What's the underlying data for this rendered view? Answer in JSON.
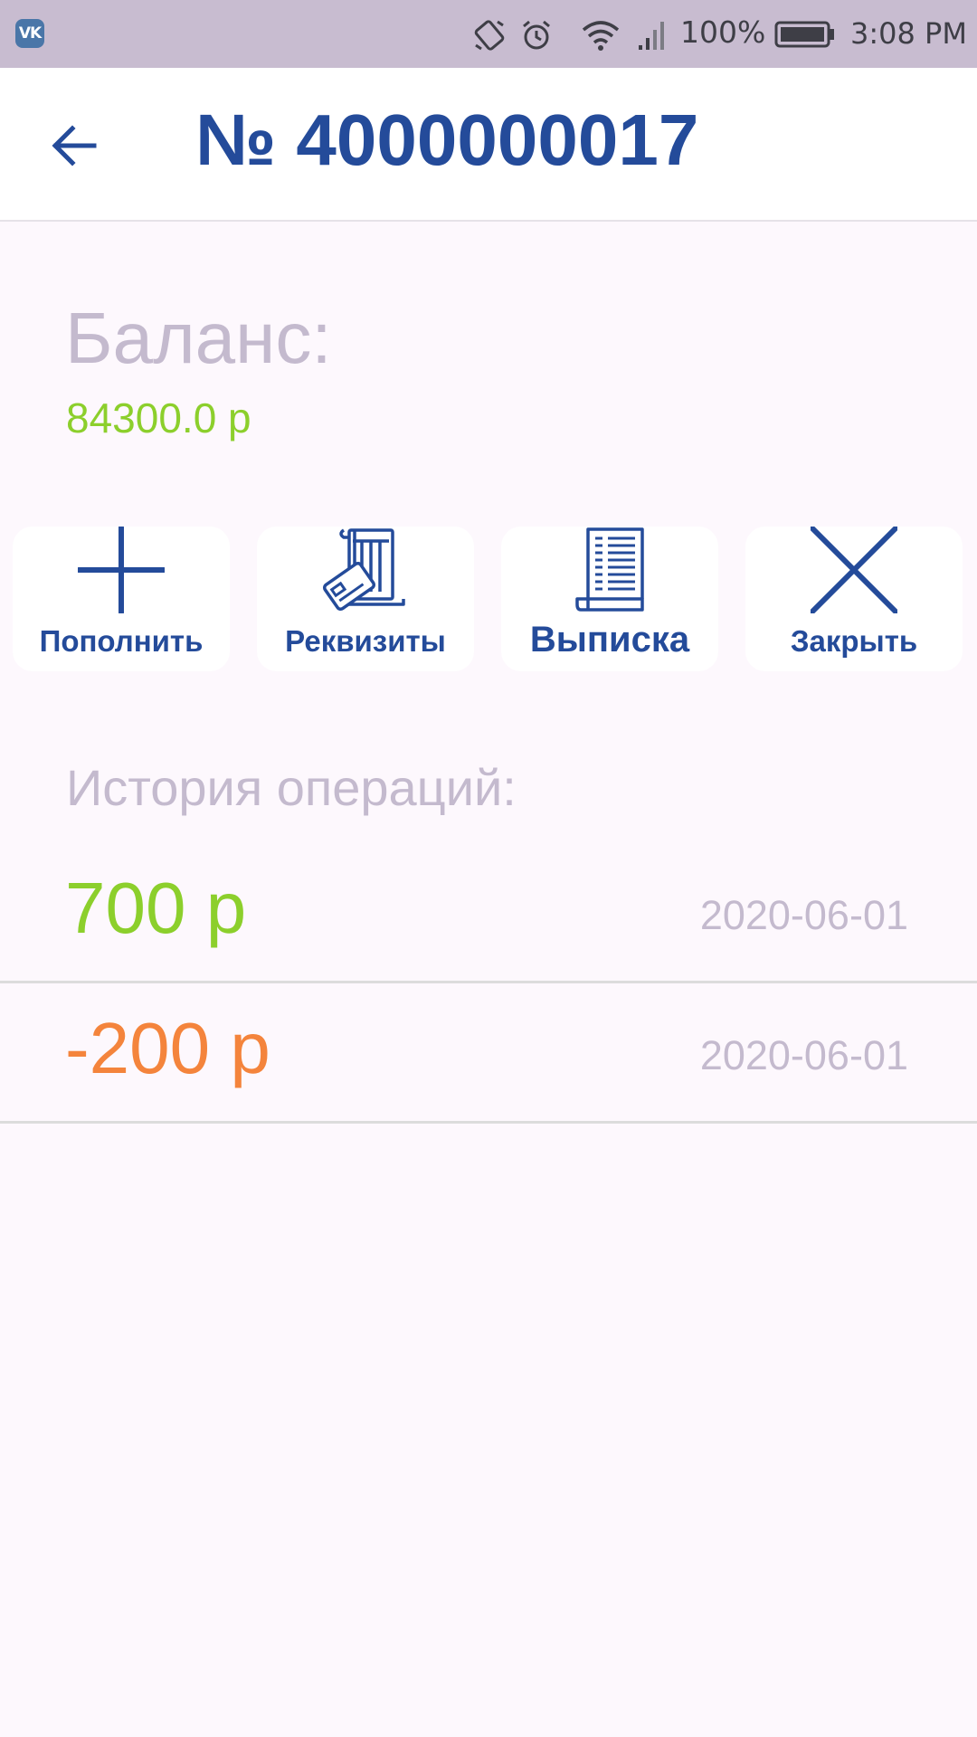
{
  "status_bar": {
    "app_icon_text": "VK",
    "battery": "100%",
    "time": "3:08 PM"
  },
  "header": {
    "title": "№ 4000000017"
  },
  "balance": {
    "label": "Баланс:",
    "value": "84300.0 р"
  },
  "actions": [
    {
      "label": "Пополнить",
      "icon": "plus-icon"
    },
    {
      "label": "Реквизиты",
      "icon": "bank-card-icon"
    },
    {
      "label": "Выписка",
      "icon": "document-icon"
    },
    {
      "label": "Закрыть",
      "icon": "close-icon"
    }
  ],
  "history": {
    "title": "История операций:",
    "operations": [
      {
        "amount": "700 р",
        "date": "2020-06-01",
        "color": "#8ccf2c"
      },
      {
        "amount": "-200 р",
        "date": "2020-06-01",
        "color": "#f4843c"
      }
    ]
  },
  "colors": {
    "primary": "#244b9a",
    "positive": "#8ccf2c",
    "negative": "#f4843c",
    "muted": "#c4bace",
    "status_bar": "#c8bcd0",
    "background": "#fdf8fd"
  }
}
